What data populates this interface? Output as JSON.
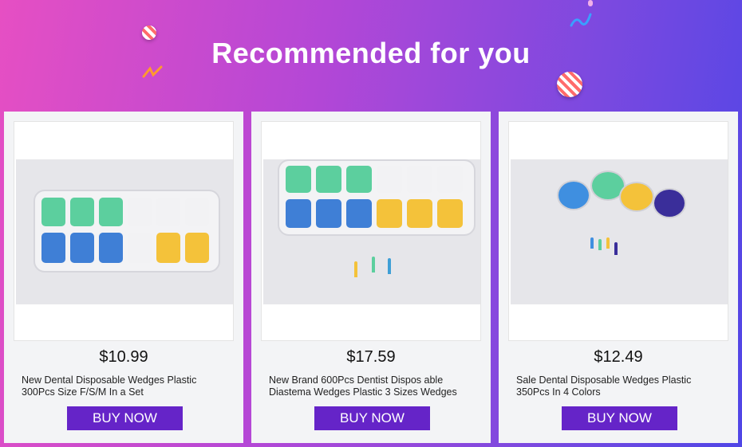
{
  "banner": {
    "title": "Recommended for you"
  },
  "colors": {
    "accent": "#6524c8",
    "gradient_start": "#e64fc3",
    "gradient_end": "#5046e6"
  },
  "products": [
    {
      "image_alt": "dental wedges tray with green, blue and yellow wedges",
      "price": "$10.99",
      "title": "New Dental Disposable Wedges Plastic 300Pcs Size F/S/M In a Set",
      "button": "BUY NOW"
    },
    {
      "image_alt": "dental wedges tray with green, blue and yellow wedges and samples",
      "price": "$17.59",
      "title": "New Brand 600Pcs Dentist Dispos able Diastema Wedges Plastic 3 Sizes Wedges",
      "button": "BUY NOW"
    },
    {
      "image_alt": "four jars of blue, green, yellow and purple dental wedges",
      "price": "$12.49",
      "title": "Sale Dental Disposable Wedges Plastic 350Pcs In 4 Colors",
      "button": "BUY NOW"
    }
  ]
}
